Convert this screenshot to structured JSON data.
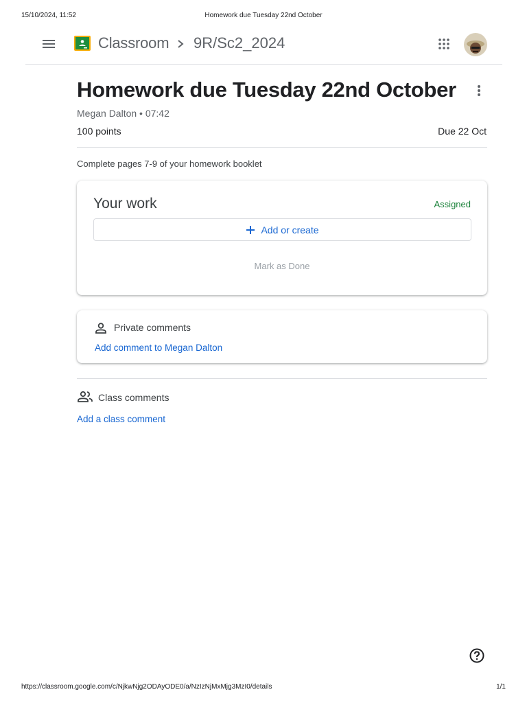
{
  "print": {
    "datetime": "15/10/2024, 11:52",
    "page_title": "Homework due Tuesday 22nd October",
    "url": "https://classroom.google.com/c/NjkwNjg2ODAyODE0/a/NzIzNjMxMjg3MzI0/details",
    "page_count": "1/1"
  },
  "header": {
    "menu_icon": "hamburger-menu-icon",
    "logo_icon": "google-classroom-logo",
    "brand": "Classroom",
    "separator_icon": "chevron-right-icon",
    "class_name": "9R/Sc2_2024",
    "apps_icon": "apps-grid-icon",
    "avatar_icon": "user-avatar"
  },
  "assignment": {
    "title": "Homework due Tuesday 22nd October",
    "author_time": "Megan Dalton • 07:42",
    "points": "100 points",
    "due": "Due 22 Oct",
    "instructions": "Complete pages 7-9 of your homework booklet",
    "more_icon": "more-vert-icon"
  },
  "your_work": {
    "title": "Your work",
    "status": "Assigned",
    "add_label": "Add or create",
    "mark_done_label": "Mark as Done"
  },
  "private_comments": {
    "title": "Private comments",
    "add_label": "Add comment to Megan Dalton"
  },
  "class_comments": {
    "title": "Class comments",
    "add_label": "Add a class comment"
  },
  "colors": {
    "accent_blue": "#1967d2",
    "assigned_green": "#188038",
    "muted_grey": "#5f6368"
  }
}
